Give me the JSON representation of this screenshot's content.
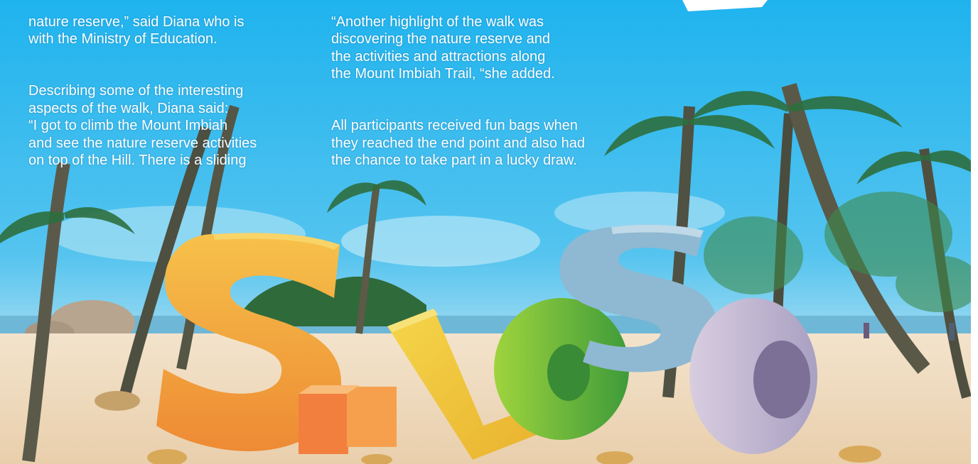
{
  "article": {
    "col1": {
      "p1": "nature reserve,” said Diana who is\nwith the Ministry of Education.",
      "p2": "Describing some of the interesting\naspects of the walk, Diana said:\n“I got to climb the Mount Imbiah\nand see the nature reserve activities\non top of the Hill. There is a sliding"
    },
    "col2": {
      "p1": "“Another highlight of the walk was\ndiscovering the nature reserve and\nthe activities and attractions along\nthe Mount Imbiah Trail, “she added.",
      "p2": "All participants received fun bags when\nthey reached the end point and also had\nthe chance to take part in a lucky draw."
    }
  },
  "photo": {
    "subject": "Siloso letter sculpture on the beach",
    "colors": {
      "sky_top": "#22b4ee",
      "sky_bottom": "#8fd4ee",
      "sand": "#f0dcc0",
      "letter_s": "#f0a23a",
      "letter_i": "#f07a3a",
      "letter_l": "#f2c93a",
      "letter_o1": "#6fbf3a",
      "letter_s2": "#8fb6cf",
      "letter_o2": "#c7b4cc",
      "palm": "#2d6f3f"
    }
  }
}
